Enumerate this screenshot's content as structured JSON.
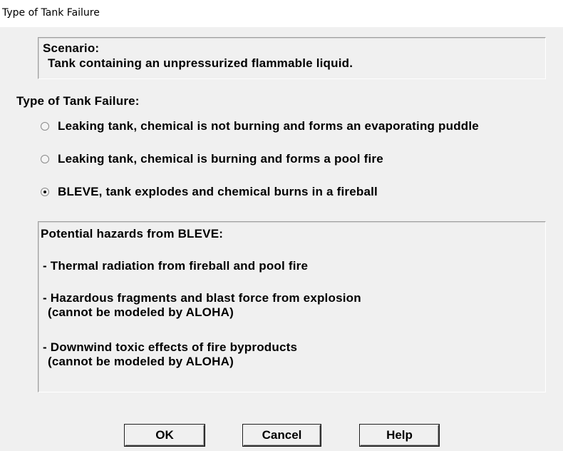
{
  "window": {
    "title": "Type of Tank Failure"
  },
  "scenario": {
    "heading": "Scenario:",
    "text": "Tank containing an unpressurized flammable liquid."
  },
  "failure_type": {
    "label": "Type of Tank Failure:",
    "options": [
      {
        "label": "Leaking tank, chemical is not burning and forms an evaporating puddle",
        "selected": false
      },
      {
        "label": "Leaking tank, chemical is burning and forms a pool fire",
        "selected": false
      },
      {
        "label": "BLEVE, tank explodes and chemical burns in a fireball",
        "selected": true
      }
    ]
  },
  "hazards": {
    "heading": "Potential hazards from BLEVE:",
    "items": [
      {
        "line1": "- Thermal radiation from fireball and pool fire",
        "line2": ""
      },
      {
        "line1": "- Hazardous fragments and blast force from explosion",
        "line2": "(cannot be modeled by ALOHA)"
      },
      {
        "line1": "- Downwind toxic effects of fire byproducts",
        "line2": "(cannot be modeled by ALOHA)"
      }
    ]
  },
  "buttons": {
    "ok": "OK",
    "cancel": "Cancel",
    "help": "Help"
  }
}
